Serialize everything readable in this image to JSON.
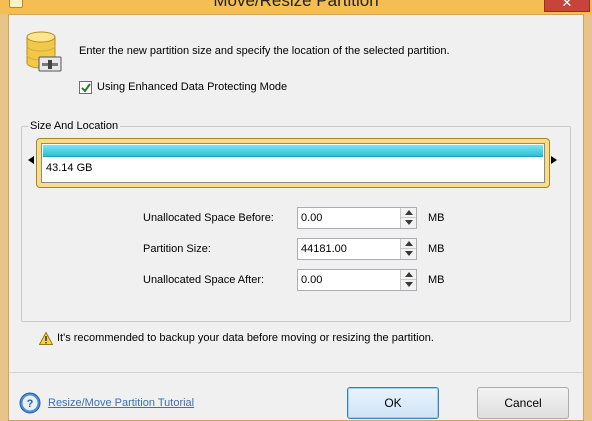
{
  "window": {
    "title": "Move/Resize Partition",
    "close_glyph": "✕"
  },
  "intro": {
    "text": "Enter the new partition size and specify the location of the selected partition.",
    "icon": "database-icon"
  },
  "enhanced_mode": {
    "label": "Using Enhanced Data Protecting Mode",
    "checked": true
  },
  "size_and_location": {
    "group_label": "Size And Location",
    "partition_size_text": "43.14 GB",
    "bar_color": "#2bbfd8",
    "fields": [
      {
        "label": "Unallocated Space Before:",
        "value": "0.00",
        "unit": "MB"
      },
      {
        "label": "Partition Size:",
        "value": "44181.00",
        "unit": "MB"
      },
      {
        "label": "Unallocated Space After:",
        "value": "0.00",
        "unit": "MB"
      }
    ]
  },
  "warning": {
    "icon": "warning-icon",
    "text": "It's recommended to backup your data before moving or resizing the partition."
  },
  "footer": {
    "help_icon": "help-icon",
    "tutorial_link": "Resize/Move Partition Tutorial",
    "ok_label": "OK",
    "cancel_label": "Cancel"
  }
}
